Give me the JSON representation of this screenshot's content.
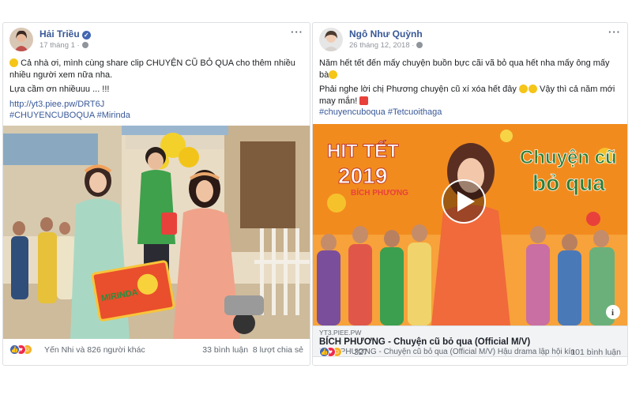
{
  "left_post": {
    "author": "Hải Triều",
    "time": "17 tháng 1 ·",
    "text_line1": "Cả nhà ơi, mình cùng share clip CHUYỆN CŨ BỎ QUA cho thêm nhiều nhiều người xem nữa nha.",
    "text_line2": "Lựa cầm ơn nhiềuuu ... !!!",
    "link": "http://yt3.piee.pw/DRT6J",
    "hashtags": "#CHUYENCUBOQUA #Mirinda",
    "reactions_text": "Yến Nhi và 826 người khác",
    "comments": "33 bình luận",
    "shares": "8 lượt chia sẻ",
    "gift_box_text": "MIRINDA"
  },
  "right_post": {
    "author": "Ngô Như Quỳnh",
    "time": "26 tháng 12, 2018 ·",
    "text_line1": "Năm hết tết đến mấy chuyện buồn bực cãi vã bỏ qua hết nha mấy ông mấy bà",
    "text_line2": "Phải nghe lời chị Phương chuyện cũ xí xóa hết đây",
    "text_line2b": "Vậy thì cả năm mới may mắn!",
    "hashtags": "#chuyencuboqua #Tetcuoithaga",
    "banner_left_line1": "HIT TẾT",
    "banner_left_line2": "2019",
    "banner_left_line3": "BÍCH PHƯƠNG",
    "banner_right_line1": "Chuyện cũ",
    "banner_right_line2": "bỏ qua",
    "preview_domain": "YT3.PIEE.PW",
    "preview_title": "BÍCH PHƯƠNG - Chuyện cũ bỏ qua (Official M/V)",
    "preview_desc": "BÍCH PHƯƠNG - Chuyện cũ bỏ qua (Official M/V) Hậu drama lập hội kín",
    "reactions_count": "327",
    "comments": "101 bình luận"
  },
  "colors": {
    "link_blue": "#385898",
    "like_blue": "#4267b2",
    "love_red": "#f0284a",
    "haha_yellow": "#f7b125",
    "banner_orange": "#f28b1e"
  },
  "icons": [
    "verified-icon",
    "globe-icon",
    "more-icon",
    "play-icon",
    "info-icon",
    "like-icon",
    "love-icon",
    "haha-icon"
  ]
}
